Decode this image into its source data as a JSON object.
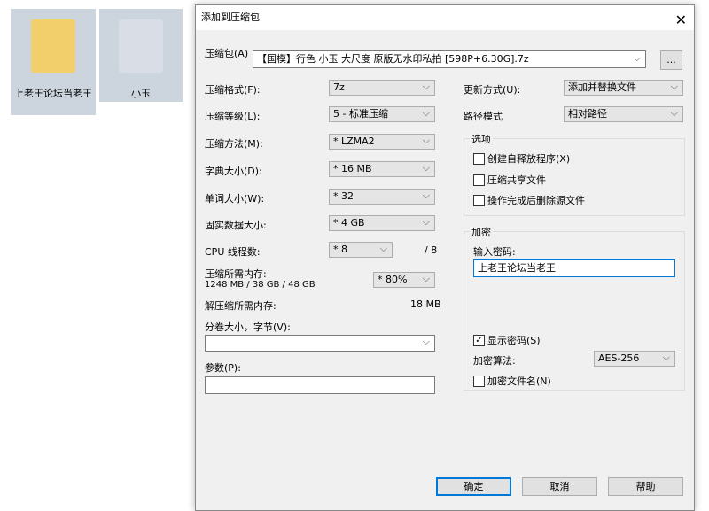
{
  "desktop": {
    "items": [
      {
        "label": "上老王论坛当老王"
      },
      {
        "label": "小玉"
      }
    ]
  },
  "dialog": {
    "title": "添加到压缩包",
    "archive_label": "压缩包(A)",
    "archive_value": "【国模】行色 小玉 大尺度 原版无水印私拍 [598P+6.30G].7z",
    "browse": "...",
    "format_label": "压缩格式(F):",
    "format": "7z",
    "level_label": "压缩等级(L):",
    "level": "5 - 标准压缩",
    "method_label": "压缩方法(M):",
    "method": "* LZMA2",
    "dict_label": "字典大小(D):",
    "dict": "* 16 MB",
    "word_label": "单词大小(W):",
    "word": "* 32",
    "solid_label": "固实数据大小:",
    "solid": "* 4 GB",
    "cpu_label": "CPU 线程数:",
    "cpu": "* 8",
    "cpu_max": "/ 8",
    "mem_label": "压缩所需内存:",
    "mem_value": "1248 MB / 38 GB / 48 GB",
    "mem_pct": "* 80%",
    "dmem_label": "解压缩所需内存:",
    "dmem_value": "18 MB",
    "split_label": "分卷大小，字节(V):",
    "split": "",
    "params_label": "参数(P):",
    "params": "",
    "update_label": "更新方式(U):",
    "update": "添加并替换文件",
    "path_label": "路径模式",
    "path": "相对路径",
    "options_title": "选项",
    "opt_sfx": "创建自释放程序(X)",
    "opt_shared": "压缩共享文件",
    "opt_delete": "操作完成后删除源文件",
    "enc_title": "加密",
    "pw_label": "输入密码:",
    "pw": "上老王论坛当老王",
    "show_pw": "显示密码(S)",
    "alg_label": "加密算法:",
    "alg": "AES-256",
    "enc_names": "加密文件名(N)",
    "ok": "确定",
    "cancel": "取消",
    "help": "帮助"
  }
}
